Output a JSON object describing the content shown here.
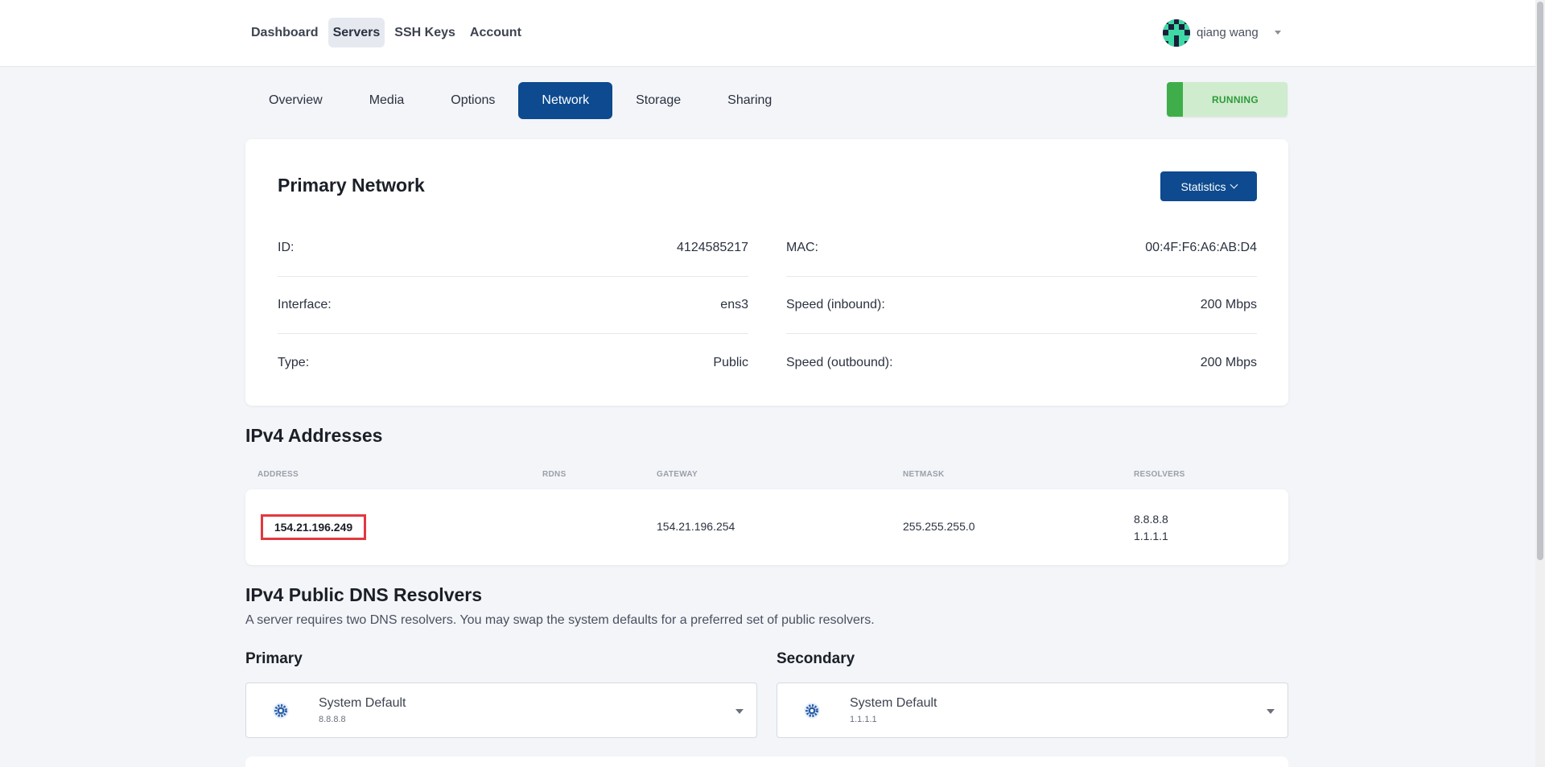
{
  "nav": {
    "items": [
      {
        "label": "Dashboard",
        "active": false
      },
      {
        "label": "Servers",
        "active": true
      },
      {
        "label": "SSH Keys",
        "active": false
      },
      {
        "label": "Account",
        "active": false
      }
    ]
  },
  "user": {
    "name": "qiang wang"
  },
  "tabs": [
    {
      "label": "Overview",
      "active": false
    },
    {
      "label": "Media",
      "active": false
    },
    {
      "label": "Options",
      "active": false
    },
    {
      "label": "Network",
      "active": true
    },
    {
      "label": "Storage",
      "active": false
    },
    {
      "label": "Sharing",
      "active": false
    }
  ],
  "status": {
    "label": "RUNNING",
    "color": "#3fae4a"
  },
  "primary_network": {
    "title": "Primary Network",
    "statistics_label": "Statistics",
    "left": [
      {
        "key": "ID:",
        "value": "4124585217"
      },
      {
        "key": "Interface:",
        "value": "ens3"
      },
      {
        "key": "Type:",
        "value": "Public"
      }
    ],
    "right": [
      {
        "key": "MAC:",
        "value": "00:4F:F6:A6:AB:D4"
      },
      {
        "key": "Speed (inbound):",
        "value": "200 Mbps"
      },
      {
        "key": "Speed (outbound):",
        "value": "200 Mbps"
      }
    ]
  },
  "ipv4": {
    "title": "IPv4 Addresses",
    "columns": {
      "address": "ADDRESS",
      "rdns": "RDNS",
      "gateway": "GATEWAY",
      "netmask": "NETMASK",
      "resolvers": "RESOLVERS"
    },
    "row": {
      "address": "154.21.196.249",
      "gateway": "154.21.196.254",
      "netmask": "255.255.255.0",
      "resolver1": "8.8.8.8",
      "resolver2": "1.1.1.1"
    }
  },
  "dns": {
    "title": "IPv4 Public DNS Resolvers",
    "description": "A server requires two DNS resolvers. You may swap the system defaults for a preferred set of public resolvers.",
    "primary": {
      "label": "Primary",
      "selected": "System Default",
      "value": "8.8.8.8"
    },
    "secondary": {
      "label": "Secondary",
      "selected": "System Default",
      "value": "1.1.1.1"
    }
  },
  "colors": {
    "accent": "#0d4a8f",
    "highlight": "#e2383f"
  },
  "icons": {
    "gear": "gear-icon",
    "caret": "chevron-down-icon"
  }
}
